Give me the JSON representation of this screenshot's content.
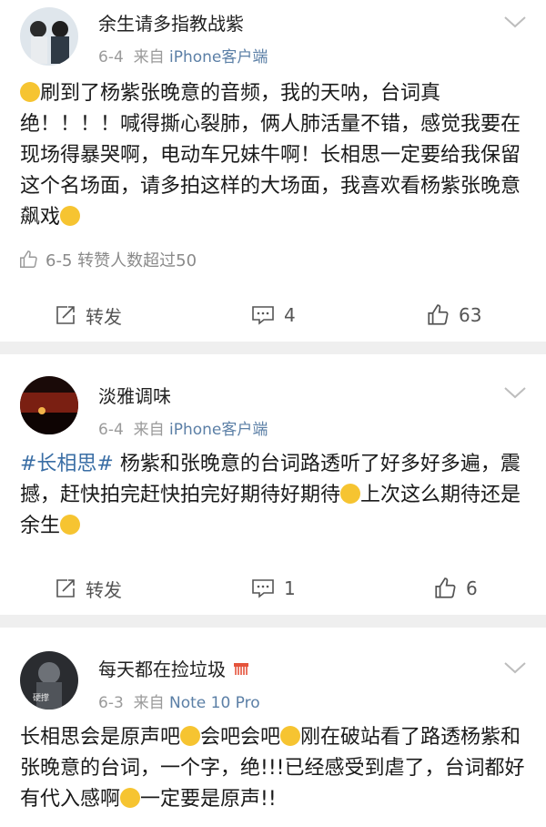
{
  "posts": [
    {
      "user": "余生请多指教战紫",
      "date": "6-4",
      "from": "来自",
      "source": "iPhone客户端",
      "text_a": "刷到了杨紫张晚意的音频，我的天呐，台词真绝！！！！喊得撕心裂肺，俩人肺活量不错，感觉我要在现场得暴哭啊，电动车兄妹牛啊！长相思一定要给我保留这个名场面，请多拍这样的大场面，我喜欢看杨紫张晚意飙戏",
      "liked_line": "6-5 转赞人数超过50",
      "repost_label": "转发",
      "comments": "4",
      "likes": "63"
    },
    {
      "user": "淡雅调味",
      "date": "6-4",
      "from": "来自",
      "source": "iPhone客户端",
      "hashtag": "#长相思#",
      "text_a": " 杨紫和张晚意的台词路透听了好多好多遍，震撼，赶快拍完赶快拍完好期待好期待",
      "text_b": "上次这么期待还是余生",
      "repost_label": "转发",
      "comments": "1",
      "likes": "6"
    },
    {
      "user": "每天都在捡垃圾",
      "avatar_text": "硬撑",
      "date": "6-3",
      "from": "来自",
      "source": "Note 10 Pro",
      "text_a": "长相思会是原声吧",
      "text_b": "会吧会吧",
      "text_c": "刚在破站看了路透杨紫和张晚意的台词，一个字，绝!!!已经感受到虐了，台词都好有代入感啊",
      "text_d": "一定要是原声!!"
    }
  ],
  "colors": {
    "link": "#3a6ea5",
    "separator": "#efefef",
    "meta": "#9a9a9a"
  },
  "icons": [
    "chevron-down-icon",
    "repost-icon",
    "comment-icon",
    "like-icon",
    "laugh-cry-emoji",
    "grin-emoji",
    "kiss-emoji",
    "fear-emoji",
    "cry-emoji"
  ]
}
